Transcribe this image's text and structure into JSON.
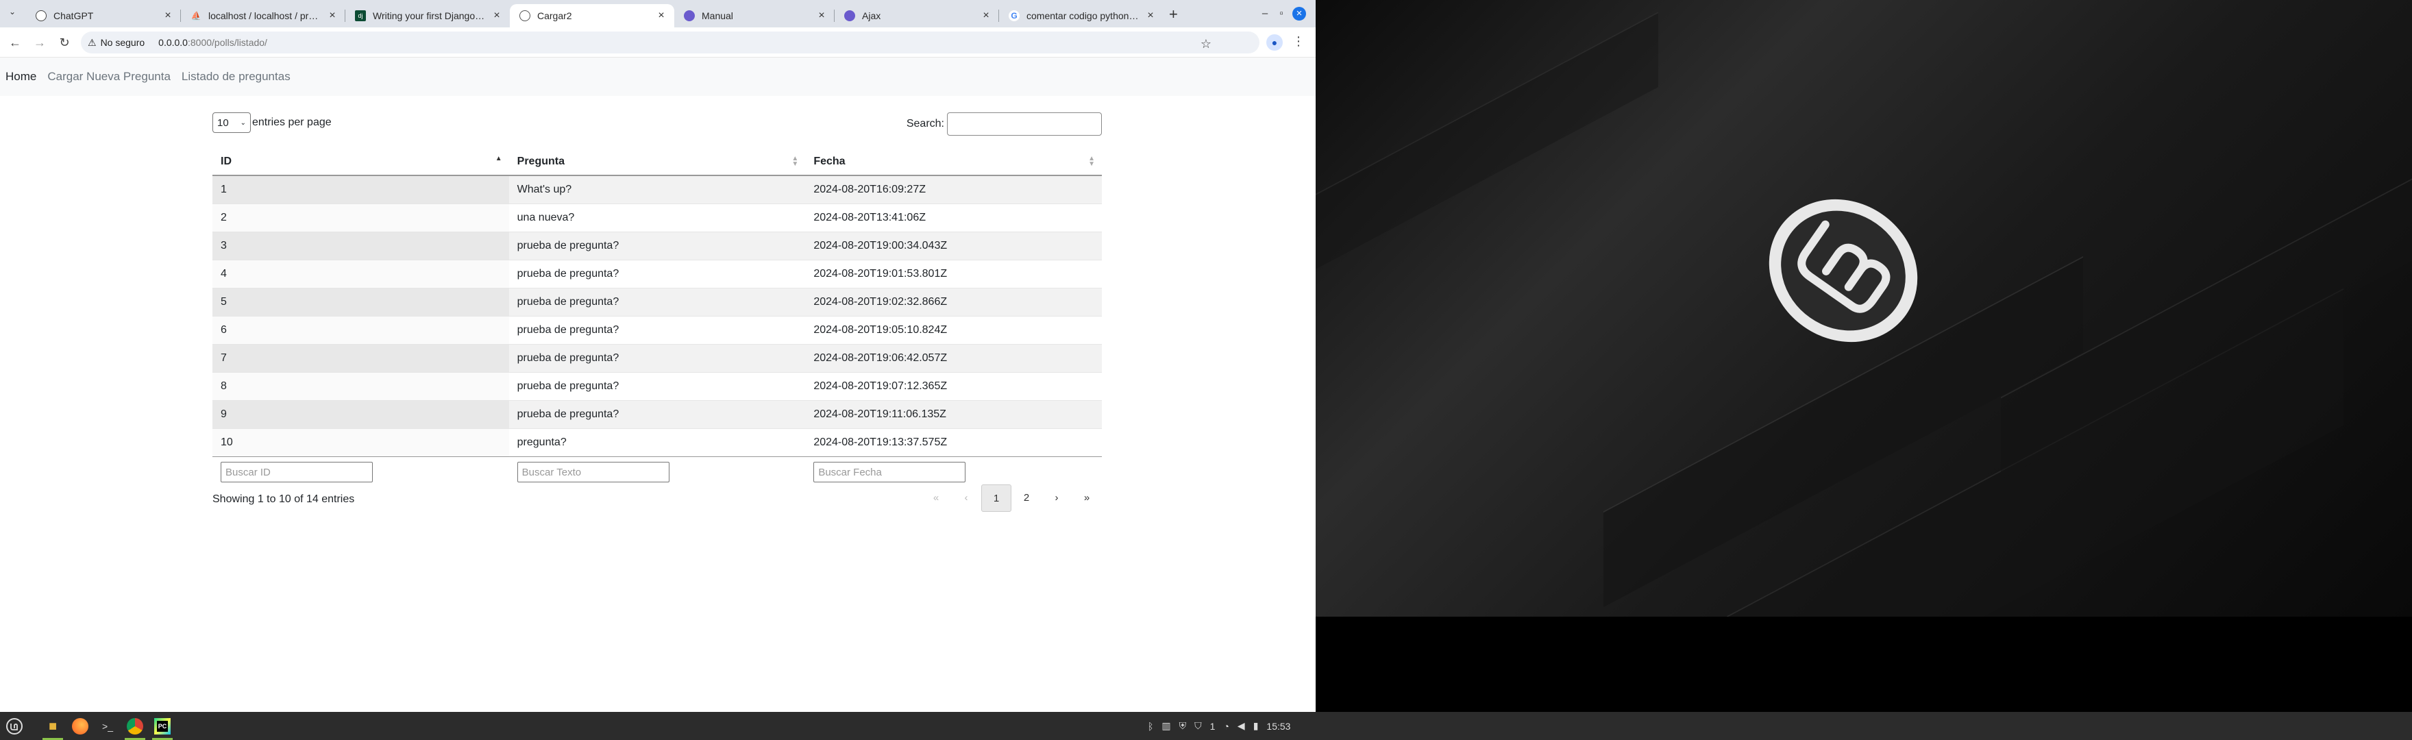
{
  "browser": {
    "tabs": [
      {
        "title": "ChatGPT",
        "icon": "chatgpt-icon",
        "active": false
      },
      {
        "title": "localhost / localhost / prueb",
        "icon": "phpmyadmin-icon",
        "active": false
      },
      {
        "title": "Writing your first Django ap",
        "icon": "django-icon",
        "active": false
      },
      {
        "title": "Cargar2",
        "icon": "globe-icon",
        "active": true
      },
      {
        "title": "Manual",
        "icon": "php-icon",
        "active": false
      },
      {
        "title": "Ajax",
        "icon": "php-icon",
        "active": false
      },
      {
        "title": "comentar codigo python - Bú",
        "icon": "google-icon",
        "active": false
      }
    ],
    "security_label": "No seguro",
    "url_host": "0.0.0.0",
    "url_path": ":8000/polls/listado/"
  },
  "navbar": {
    "brand": "Home",
    "links": [
      "Cargar Nueva Pregunta",
      "Listado de preguntas"
    ]
  },
  "datatable": {
    "page_length": "10",
    "entries_label": "entries per page",
    "search_label": "Search:",
    "columns": [
      "ID",
      "Pregunta",
      "Fecha"
    ],
    "sort_column": "ID",
    "rows": [
      [
        "1",
        "What's up?",
        "2024-08-20T16:09:27Z"
      ],
      [
        "2",
        "una nueva?",
        "2024-08-20T13:41:06Z"
      ],
      [
        "3",
        "prueba de pregunta?",
        "2024-08-20T19:00:34.043Z"
      ],
      [
        "4",
        "prueba de pregunta?",
        "2024-08-20T19:01:53.801Z"
      ],
      [
        "5",
        "prueba de pregunta?",
        "2024-08-20T19:02:32.866Z"
      ],
      [
        "6",
        "prueba de pregunta?",
        "2024-08-20T19:05:10.824Z"
      ],
      [
        "7",
        "prueba de pregunta?",
        "2024-08-20T19:06:42.057Z"
      ],
      [
        "8",
        "prueba de pregunta?",
        "2024-08-20T19:07:12.365Z"
      ],
      [
        "9",
        "prueba de pregunta?",
        "2024-08-20T19:11:06.135Z"
      ],
      [
        "10",
        "pregunta?",
        "2024-08-20T19:13:37.575Z"
      ]
    ],
    "filters": [
      "Buscar ID",
      "Buscar Texto",
      "Buscar Fecha"
    ],
    "info": "Showing 1 to 10 of 14 entries",
    "pager": {
      "first": "«",
      "prev": "‹",
      "pages": [
        "1",
        "2"
      ],
      "current": "1",
      "next": "›",
      "last": "»"
    }
  },
  "taskbar": {
    "apps": [
      "mint-menu-icon",
      "folder-icon",
      "firefox-icon",
      "terminal-icon",
      "chrome-icon",
      "pycharm-icon"
    ],
    "workspace_badge": "1",
    "clock": "15:53"
  },
  "colors": {
    "link_muted": "#6c757d",
    "accent": "#1a73e8",
    "taskbar": "#2c2c2c"
  }
}
